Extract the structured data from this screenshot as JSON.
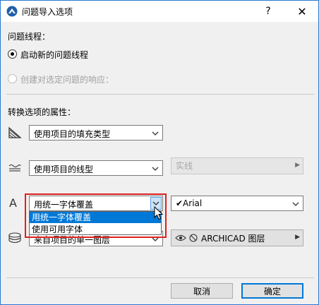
{
  "window": {
    "title": "问题导入选项",
    "help_glyph": "?",
    "close_glyph": "✕"
  },
  "thread_section": {
    "heading": "问题线程：",
    "option_new": "启动新的问题线程",
    "option_respond": "创建对选定问题的响应："
  },
  "attributes": {
    "heading": "转换选项的属性：",
    "fill_select": "使用项目的填充类型",
    "line_select": "使用项目的线型",
    "line_style_select": "实线",
    "font_select": "用统一字体覆盖",
    "font_value": "✔Arial",
    "layer_select": "来自项目的单一图层",
    "layer_value": "ARCHICAD 图层",
    "font_icon_letter": "A"
  },
  "dropdown": {
    "items": [
      "用统一字体覆盖",
      "使用可用字体"
    ]
  },
  "buttons": {
    "cancel": "取消",
    "ok": "确定"
  },
  "colors": {
    "accent": "#0078d7",
    "highlight": "#e0201f",
    "window_border": "#2b78d0"
  }
}
